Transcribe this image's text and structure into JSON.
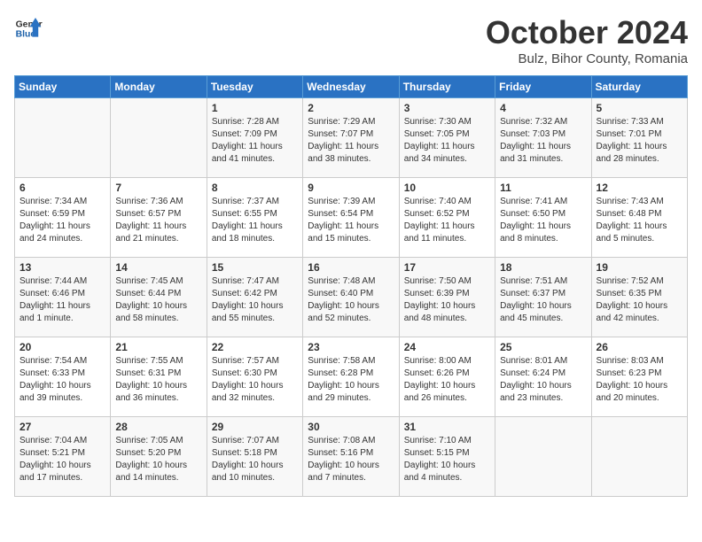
{
  "header": {
    "logo_general": "General",
    "logo_blue": "Blue",
    "month": "October 2024",
    "location": "Bulz, Bihor County, Romania"
  },
  "days_of_week": [
    "Sunday",
    "Monday",
    "Tuesday",
    "Wednesday",
    "Thursday",
    "Friday",
    "Saturday"
  ],
  "weeks": [
    [
      {
        "day": "",
        "info": ""
      },
      {
        "day": "",
        "info": ""
      },
      {
        "day": "1",
        "info": "Sunrise: 7:28 AM\nSunset: 7:09 PM\nDaylight: 11 hours and 41 minutes."
      },
      {
        "day": "2",
        "info": "Sunrise: 7:29 AM\nSunset: 7:07 PM\nDaylight: 11 hours and 38 minutes."
      },
      {
        "day": "3",
        "info": "Sunrise: 7:30 AM\nSunset: 7:05 PM\nDaylight: 11 hours and 34 minutes."
      },
      {
        "day": "4",
        "info": "Sunrise: 7:32 AM\nSunset: 7:03 PM\nDaylight: 11 hours and 31 minutes."
      },
      {
        "day": "5",
        "info": "Sunrise: 7:33 AM\nSunset: 7:01 PM\nDaylight: 11 hours and 28 minutes."
      }
    ],
    [
      {
        "day": "6",
        "info": "Sunrise: 7:34 AM\nSunset: 6:59 PM\nDaylight: 11 hours and 24 minutes."
      },
      {
        "day": "7",
        "info": "Sunrise: 7:36 AM\nSunset: 6:57 PM\nDaylight: 11 hours and 21 minutes."
      },
      {
        "day": "8",
        "info": "Sunrise: 7:37 AM\nSunset: 6:55 PM\nDaylight: 11 hours and 18 minutes."
      },
      {
        "day": "9",
        "info": "Sunrise: 7:39 AM\nSunset: 6:54 PM\nDaylight: 11 hours and 15 minutes."
      },
      {
        "day": "10",
        "info": "Sunrise: 7:40 AM\nSunset: 6:52 PM\nDaylight: 11 hours and 11 minutes."
      },
      {
        "day": "11",
        "info": "Sunrise: 7:41 AM\nSunset: 6:50 PM\nDaylight: 11 hours and 8 minutes."
      },
      {
        "day": "12",
        "info": "Sunrise: 7:43 AM\nSunset: 6:48 PM\nDaylight: 11 hours and 5 minutes."
      }
    ],
    [
      {
        "day": "13",
        "info": "Sunrise: 7:44 AM\nSunset: 6:46 PM\nDaylight: 11 hours and 1 minute."
      },
      {
        "day": "14",
        "info": "Sunrise: 7:45 AM\nSunset: 6:44 PM\nDaylight: 10 hours and 58 minutes."
      },
      {
        "day": "15",
        "info": "Sunrise: 7:47 AM\nSunset: 6:42 PM\nDaylight: 10 hours and 55 minutes."
      },
      {
        "day": "16",
        "info": "Sunrise: 7:48 AM\nSunset: 6:40 PM\nDaylight: 10 hours and 52 minutes."
      },
      {
        "day": "17",
        "info": "Sunrise: 7:50 AM\nSunset: 6:39 PM\nDaylight: 10 hours and 48 minutes."
      },
      {
        "day": "18",
        "info": "Sunrise: 7:51 AM\nSunset: 6:37 PM\nDaylight: 10 hours and 45 minutes."
      },
      {
        "day": "19",
        "info": "Sunrise: 7:52 AM\nSunset: 6:35 PM\nDaylight: 10 hours and 42 minutes."
      }
    ],
    [
      {
        "day": "20",
        "info": "Sunrise: 7:54 AM\nSunset: 6:33 PM\nDaylight: 10 hours and 39 minutes."
      },
      {
        "day": "21",
        "info": "Sunrise: 7:55 AM\nSunset: 6:31 PM\nDaylight: 10 hours and 36 minutes."
      },
      {
        "day": "22",
        "info": "Sunrise: 7:57 AM\nSunset: 6:30 PM\nDaylight: 10 hours and 32 minutes."
      },
      {
        "day": "23",
        "info": "Sunrise: 7:58 AM\nSunset: 6:28 PM\nDaylight: 10 hours and 29 minutes."
      },
      {
        "day": "24",
        "info": "Sunrise: 8:00 AM\nSunset: 6:26 PM\nDaylight: 10 hours and 26 minutes."
      },
      {
        "day": "25",
        "info": "Sunrise: 8:01 AM\nSunset: 6:24 PM\nDaylight: 10 hours and 23 minutes."
      },
      {
        "day": "26",
        "info": "Sunrise: 8:03 AM\nSunset: 6:23 PM\nDaylight: 10 hours and 20 minutes."
      }
    ],
    [
      {
        "day": "27",
        "info": "Sunrise: 7:04 AM\nSunset: 5:21 PM\nDaylight: 10 hours and 17 minutes."
      },
      {
        "day": "28",
        "info": "Sunrise: 7:05 AM\nSunset: 5:20 PM\nDaylight: 10 hours and 14 minutes."
      },
      {
        "day": "29",
        "info": "Sunrise: 7:07 AM\nSunset: 5:18 PM\nDaylight: 10 hours and 10 minutes."
      },
      {
        "day": "30",
        "info": "Sunrise: 7:08 AM\nSunset: 5:16 PM\nDaylight: 10 hours and 7 minutes."
      },
      {
        "day": "31",
        "info": "Sunrise: 7:10 AM\nSunset: 5:15 PM\nDaylight: 10 hours and 4 minutes."
      },
      {
        "day": "",
        "info": ""
      },
      {
        "day": "",
        "info": ""
      }
    ]
  ]
}
